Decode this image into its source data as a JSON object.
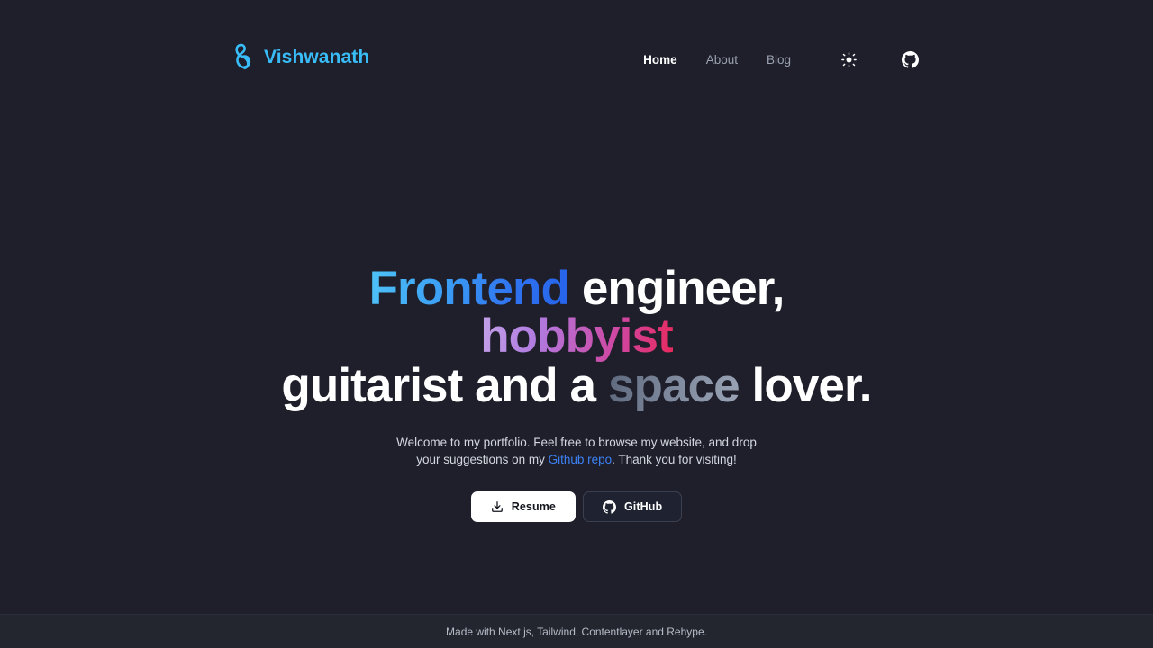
{
  "header": {
    "brand": {
      "logo_icon": "infinity-knot-logo-icon",
      "name": "Vishwanath",
      "color": "#38bdf8"
    },
    "nav": {
      "items": [
        {
          "label": "Home",
          "active": true
        },
        {
          "label": "About",
          "active": false
        },
        {
          "label": "Blog",
          "active": false
        }
      ],
      "theme_toggle_icon": "sun-icon",
      "github_icon": "github-icon"
    }
  },
  "hero": {
    "title": {
      "line1": [
        {
          "text": "Frontend",
          "style": "gradient-blue"
        },
        {
          "text": " engineer, ",
          "style": "plain-white"
        },
        {
          "text": "hobbyist",
          "style": "gradient-pink"
        }
      ],
      "line2": [
        {
          "text": "guitarist and a ",
          "style": "plain-white"
        },
        {
          "text": "space",
          "style": "gradient-slate"
        },
        {
          "text": " lover.",
          "style": "plain-white"
        }
      ],
      "plain_text": "Frontend engineer, hobbyist guitarist and a space lover."
    },
    "description": {
      "before_link": "Welcome to my portfolio. Feel free to browse my website, and drop your suggestions on my ",
      "link_text": "Github repo",
      "after_link": ". Thank you for visiting!"
    },
    "actions": [
      {
        "label": "Resume",
        "icon": "download-icon",
        "variant": "solid-white"
      },
      {
        "label": "GitHub",
        "icon": "github-icon",
        "variant": "outline-dark"
      }
    ]
  },
  "footer": {
    "text": "Made with Next.js, Tailwind, Contentlayer and Rehype."
  },
  "theme": {
    "background": "#1f1f2b",
    "footer_background": "#23262f",
    "accent_blue": "#38bdf8",
    "link_blue": "#3b82f6",
    "text_primary": "#ffffff",
    "text_muted": "#9aa2b1"
  }
}
